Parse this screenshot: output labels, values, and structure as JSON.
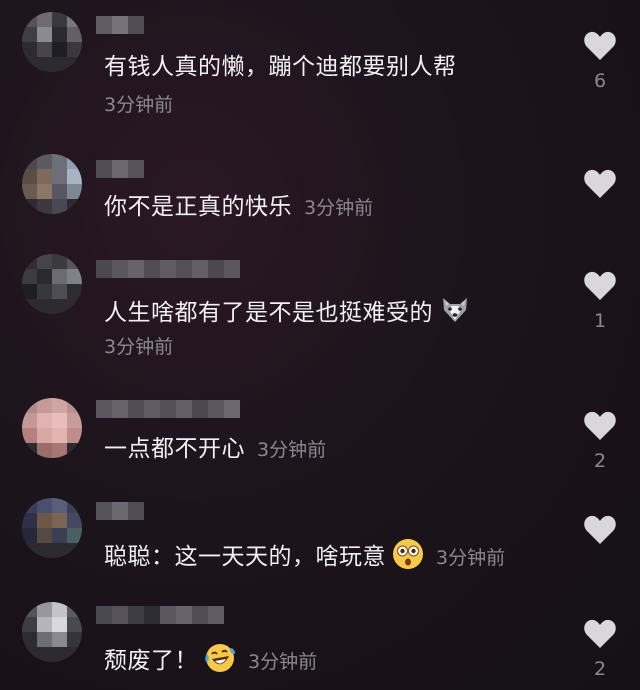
{
  "comments": [
    {
      "text": "有钱人真的懒，蹦个迪都要别人帮",
      "time": "3分钟前",
      "likes": "6"
    },
    {
      "text": "你不是正真的快乐",
      "time": "3分钟前",
      "likes": ""
    },
    {
      "text": "人生啥都有了是不是也挺难受的",
      "time": "3分钟前",
      "likes": "1",
      "emoji": "husky-dog-emoji"
    },
    {
      "text": "一点都不开心",
      "time": "3分钟前",
      "likes": "2"
    },
    {
      "text": "聪聪：这一天天的，啥玩意",
      "time": "3分钟前",
      "likes": "",
      "emoji": "shocked-face-emoji"
    },
    {
      "text": "颓废了！",
      "time": "3分钟前",
      "likes": "2",
      "emoji": "laughing-tears-face-emoji"
    }
  ],
  "icons": {
    "like": "heart-icon"
  },
  "colors": {
    "background": "#1c141b",
    "text": "#f2f0f2",
    "muted": "#8b8890",
    "heart": "#d9d7da"
  }
}
